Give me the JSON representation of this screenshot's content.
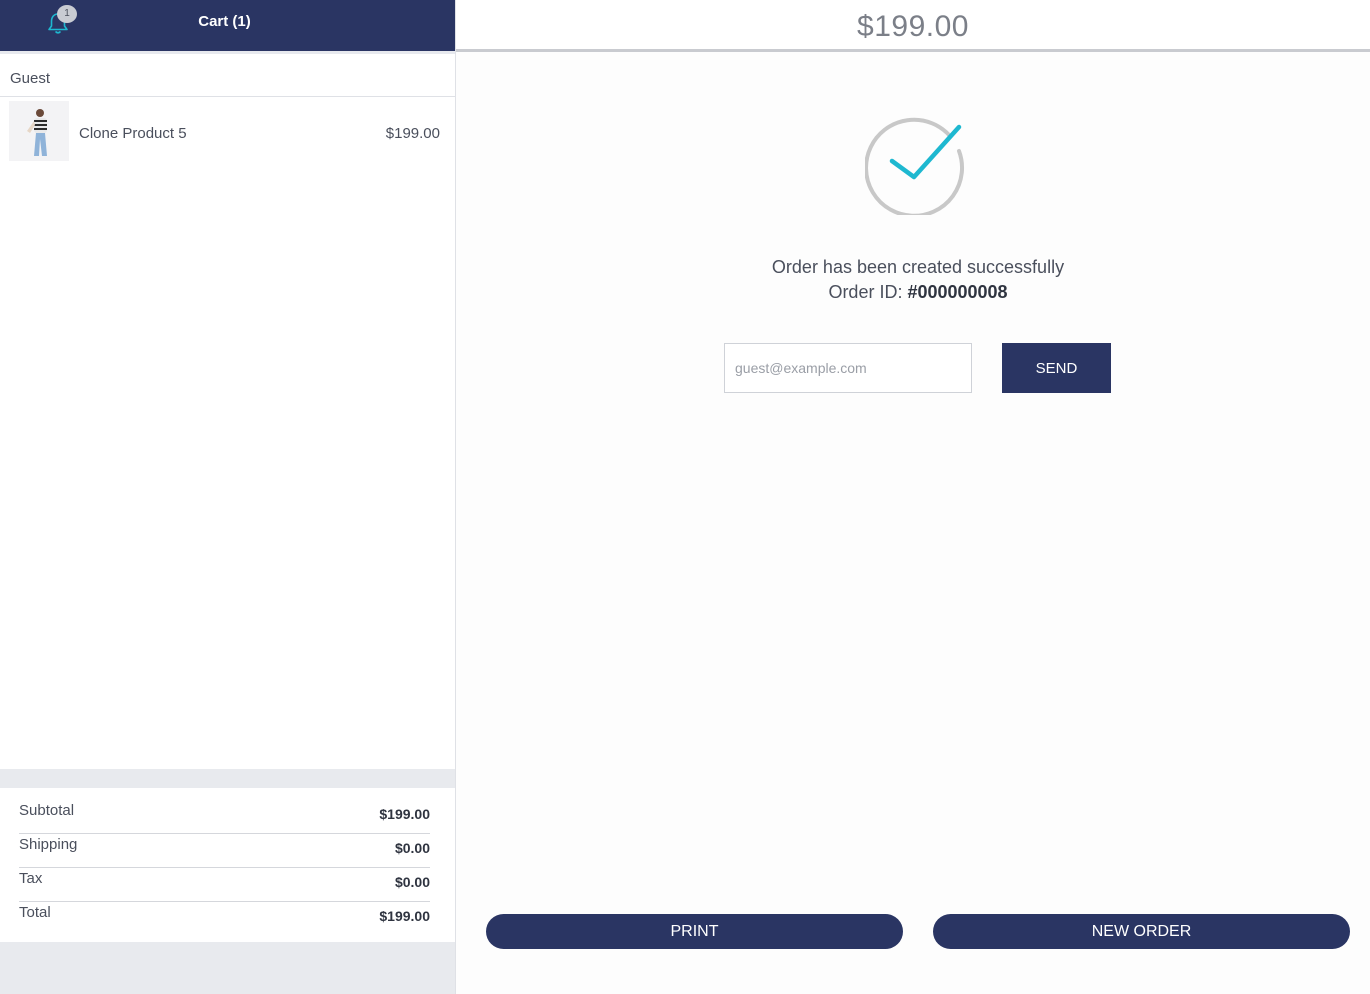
{
  "notifications": {
    "count": "1",
    "icon": "bell-icon"
  },
  "cart": {
    "title": "Cart (1)",
    "customer": "Guest"
  },
  "items": [
    {
      "name": "Clone Product 5",
      "price": "$199.00"
    }
  ],
  "totals": {
    "subtotal_label": "Subtotal",
    "subtotal": "$199.00",
    "shipping_label": "Shipping",
    "shipping": "$0.00",
    "tax_label": "Tax",
    "tax": "$0.00",
    "total_label": "Total",
    "total": "$199.00"
  },
  "checkout": {
    "grand_total": "$199.00",
    "success_message": "Order has been created successfully",
    "order_id_label": "Order ID: ",
    "order_id": "#000000008",
    "email_placeholder": "guest@example.com",
    "send_label": "SEND",
    "print_label": "PRINT",
    "new_order_label": "NEW ORDER"
  },
  "colors": {
    "primary": "#2a3563",
    "check": "#1eb8d0",
    "ring": "#c8c8c8"
  }
}
